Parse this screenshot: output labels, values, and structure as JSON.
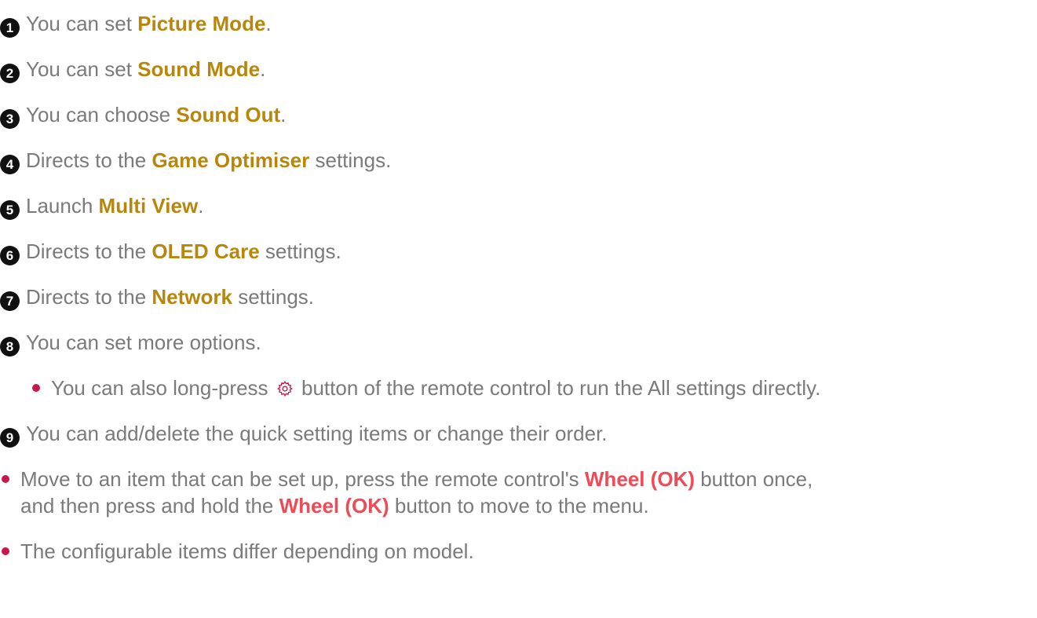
{
  "steps": [
    {
      "num": "1",
      "pre": "You can set ",
      "kw": "Picture Mode",
      "post": "."
    },
    {
      "num": "2",
      "pre": "You can set ",
      "kw": "Sound Mode",
      "post": "."
    },
    {
      "num": "3",
      "pre": "You can choose ",
      "kw": "Sound Out",
      "post": "."
    },
    {
      "num": "4",
      "pre": "Directs to the ",
      "kw": "Game Optimiser",
      "post": " settings."
    },
    {
      "num": "5",
      "pre": "Launch ",
      "kw": "Multi View",
      "post": "."
    },
    {
      "num": "6",
      "pre": "Directs to the ",
      "kw": "OLED Care",
      "post": " settings."
    },
    {
      "num": "7",
      "pre": "Directs to the ",
      "kw": "Network",
      "post": " settings."
    },
    {
      "num": "8",
      "text": "You can set more options."
    },
    {
      "num": "9",
      "text": "You can add/delete the quick setting items or change their order."
    }
  ],
  "sub_note": {
    "pre": "You can also long-press ",
    "icon": "settings-gear-icon",
    "post": " button of the remote control to run the All settings directly."
  },
  "notes": [
    {
      "line1_pre": "Move to an item that can be set up, press the remote control's ",
      "line1_kw": "Wheel (OK)",
      "line1_post": " button once,",
      "line2_pre": "and then press and hold the ",
      "line2_kw": "Wheel (OK)",
      "line2_post": " button to move to the menu."
    },
    {
      "text": "The configurable items differ depending on model."
    }
  ],
  "colors": {
    "keyword": "#b8860b",
    "keyword_red": "#f04a56",
    "bullet": "#c8174a",
    "text": "#7a7a7a",
    "number_circle": "#111111"
  }
}
